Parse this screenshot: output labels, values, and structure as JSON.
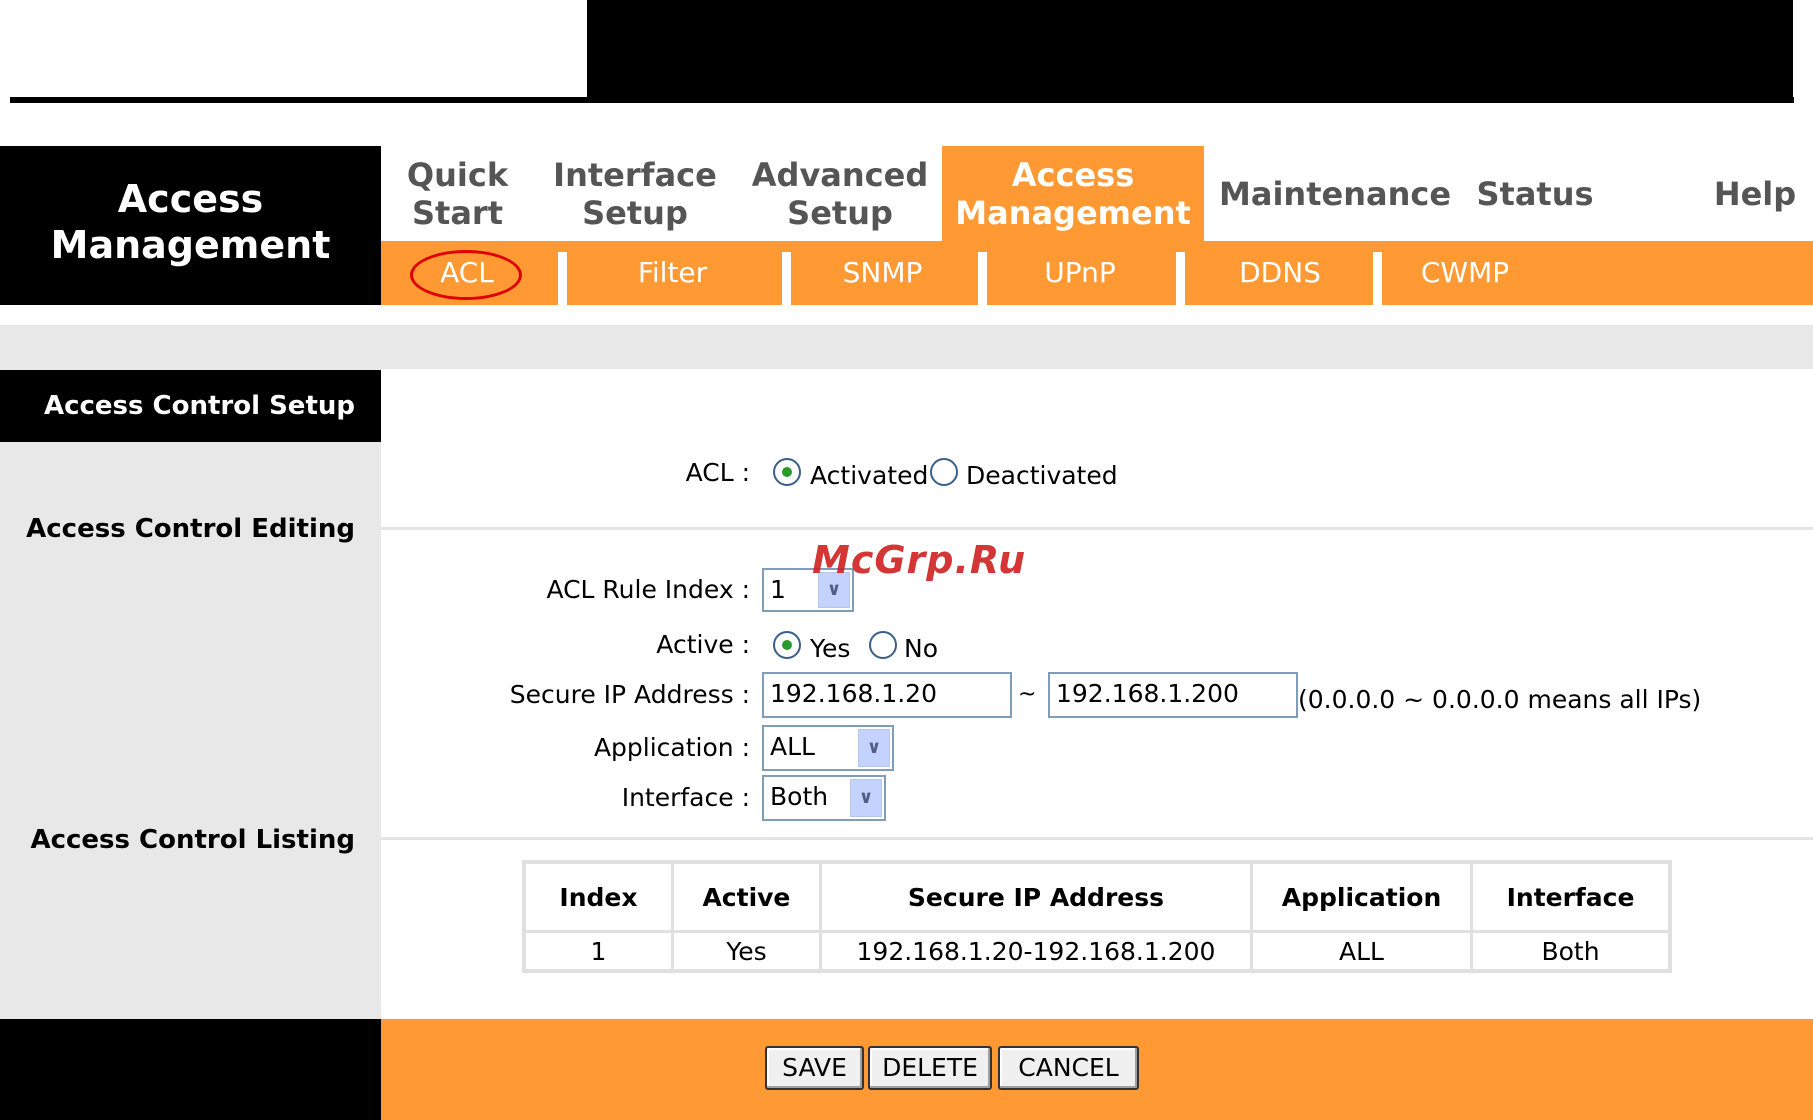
{
  "header": {
    "section_title_line1": "Access",
    "section_title_line2": "Management",
    "tabs": [
      {
        "line1": "Quick",
        "line2": "Start"
      },
      {
        "line1": "Interface",
        "line2": "Setup"
      },
      {
        "line1": "Advanced",
        "line2": "Setup"
      },
      {
        "line1": "Access",
        "line2": "Management"
      },
      {
        "line1": "Maintenance",
        "line2": ""
      },
      {
        "line1": "Status",
        "line2": ""
      },
      {
        "line1": "Help",
        "line2": ""
      }
    ],
    "subtabs": [
      "ACL",
      "Filter",
      "SNMP",
      "UPnP",
      "DDNS",
      "CWMP"
    ]
  },
  "sections": {
    "setup": "Access Control Setup",
    "editing": "Access Control Editing",
    "listing": "Access Control Listing"
  },
  "form": {
    "acl_label": "ACL :",
    "acl_activated": "Activated",
    "acl_deactivated": "Deactivated",
    "rule_index_label": "ACL Rule Index :",
    "rule_index_value": "1",
    "active_label": "Active :",
    "active_yes": "Yes",
    "active_no": "No",
    "secure_ip_label": "Secure IP Address :",
    "ip_start": "192.168.1.20",
    "ip_tilde": "~",
    "ip_end": "192.168.1.200",
    "ip_hint": "(0.0.0.0 ~ 0.0.0.0 means all IPs)",
    "application_label": "Application :",
    "application_value": "ALL",
    "interface_label": "Interface :",
    "interface_value": "Both"
  },
  "table": {
    "headers": [
      "Index",
      "Active",
      "Secure IP Address",
      "Application",
      "Interface"
    ],
    "rows": [
      [
        "1",
        "Yes",
        "192.168.1.20-192.168.1.200",
        "ALL",
        "Both"
      ]
    ]
  },
  "buttons": {
    "save": "SAVE",
    "delete": "DELETE",
    "cancel": "CANCEL"
  },
  "watermark": "McGrp.Ru",
  "colors": {
    "accent": "#ff9933",
    "highlight_circle": "#e00000"
  }
}
